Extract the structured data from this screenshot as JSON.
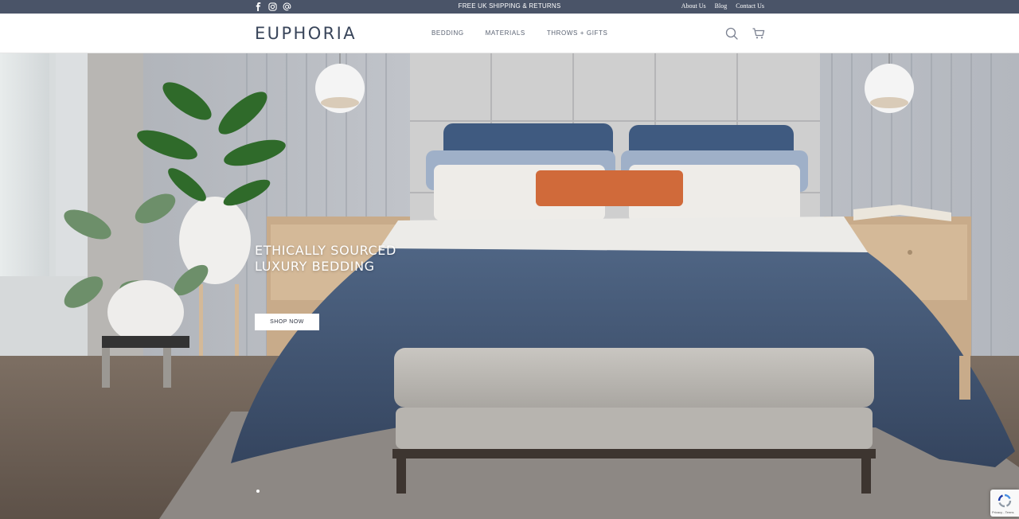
{
  "topbar": {
    "social_icons": [
      "facebook-icon",
      "instagram-icon",
      "email-icon"
    ],
    "announcement": "FREE UK SHIPPING & RETURNS",
    "links": [
      "About Us",
      "Blog",
      "Contact Us"
    ],
    "background": "#4a5468"
  },
  "header": {
    "logo": "EUPHORIA",
    "nav": [
      "BEDDING",
      "MATERIALS",
      "THROWS + GIFTS"
    ],
    "icons": [
      "search-icon",
      "cart-icon"
    ],
    "logo_color": "#39455a"
  },
  "hero": {
    "title_line1": "ETHICALLY SOURCED",
    "title_line2": "LUXURY BEDDING",
    "cta": "SHOP NOW",
    "slide_count": 1,
    "active_slide": 1
  },
  "recaptcha": {
    "terms": "Privacy - Terms"
  }
}
